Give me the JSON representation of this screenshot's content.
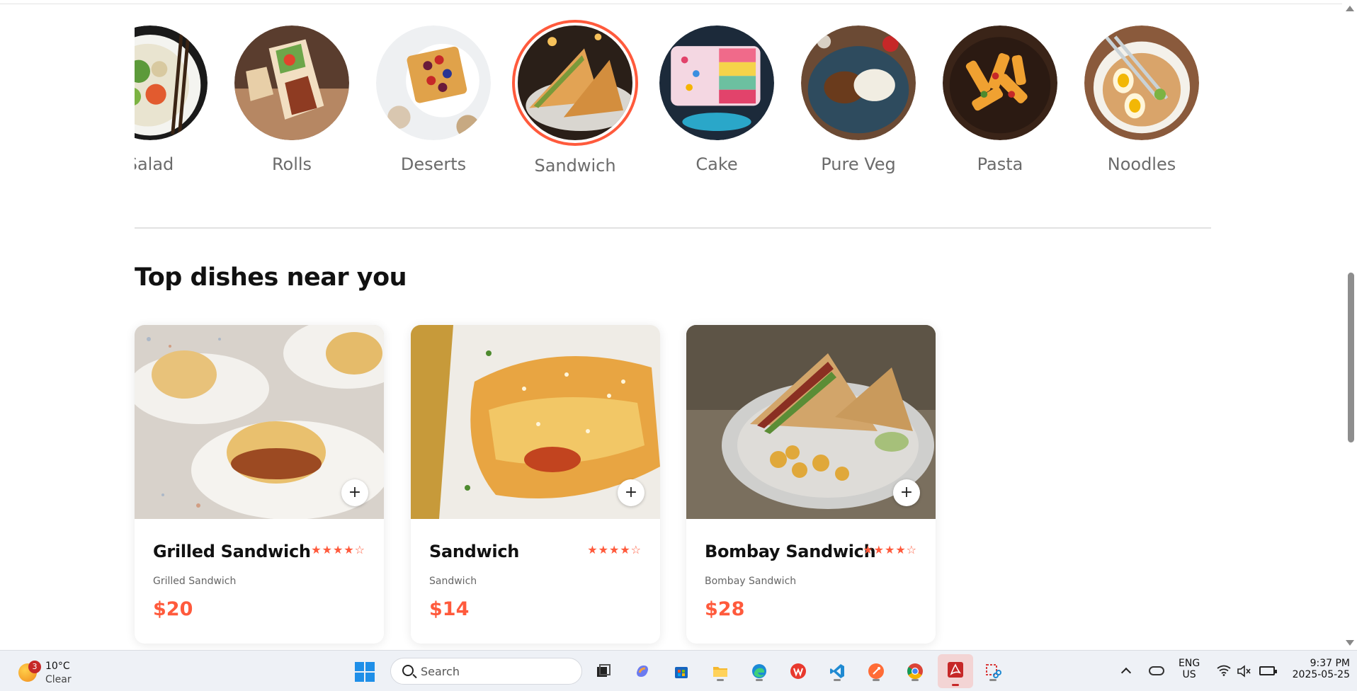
{
  "categories": [
    {
      "label": "Salad",
      "icon": "salad-image"
    },
    {
      "label": "Rolls",
      "icon": "rolls-image"
    },
    {
      "label": "Deserts",
      "icon": "deserts-image"
    },
    {
      "label": "Sandwich",
      "icon": "sandwich-image",
      "active": true
    },
    {
      "label": "Cake",
      "icon": "cake-image"
    },
    {
      "label": "Pure Veg",
      "icon": "pure-veg-image"
    },
    {
      "label": "Pasta",
      "icon": "pasta-image"
    },
    {
      "label": "Noodles",
      "icon": "noodles-image"
    }
  ],
  "section": {
    "title": "Top dishes near you"
  },
  "dishes": [
    {
      "name": "Grilled Sandwich",
      "description": "Grilled Sandwich",
      "price": "$20",
      "rating_stars": "★★★★☆",
      "rating": 4,
      "add_label": "+"
    },
    {
      "name": "Sandwich",
      "description": "Sandwich",
      "price": "$14",
      "rating_stars": "★★★★☆",
      "rating": 4,
      "add_label": "+"
    },
    {
      "name": "Bombay Sandwich",
      "description": "Bombay Sandwich",
      "price": "$28",
      "rating_stars": "★★★★☆",
      "rating": 4,
      "add_label": "+"
    }
  ],
  "colors": {
    "accent": "#ff5a3c",
    "text": "#111111",
    "muted": "#6b6b6b"
  },
  "taskbar": {
    "weather": {
      "badge": "3",
      "temp": "10°C",
      "condition": "Clear"
    },
    "search_placeholder": "Search",
    "apps": [
      "task-view",
      "copilot",
      "microsoft-store",
      "file-explorer",
      "edge",
      "wps-office",
      "vs-code",
      "postman",
      "chrome",
      "acrobat",
      "snipping-tool"
    ],
    "lang_line1": "ENG",
    "lang_line2": "US",
    "time": "9:37 PM",
    "date": "2025-05-25"
  }
}
